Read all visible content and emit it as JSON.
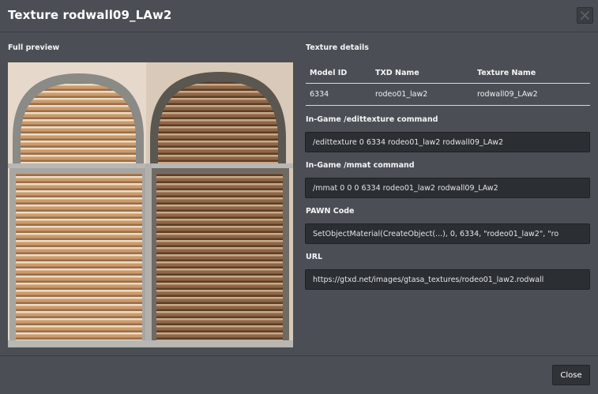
{
  "dialog": {
    "title": "Texture rodwall09_LAw2"
  },
  "preview": {
    "label": "Full preview"
  },
  "details": {
    "label": "Texture details",
    "columns": [
      "Model ID",
      "TXD Name",
      "Texture Name"
    ],
    "row": [
      "6334",
      "rodeo01_law2",
      "rodwall09_LAw2"
    ]
  },
  "commands": {
    "edittexture_label": "In-Game /edittexture command",
    "edittexture_value": "/edittexture 0 6334 rodeo01_law2 rodwall09_LAw2",
    "mmat_label": "In-Game /mmat command",
    "mmat_value": "/mmat 0 0 0 6334 rodeo01_law2 rodwall09_LAw2",
    "pawn_label": "PAWN Code",
    "pawn_value": "SetObjectMaterial(CreateObject(...), 0, 6334, \"rodeo01_law2\", \"ro",
    "url_label": "URL",
    "url_value": "https://gtxd.net/images/gtasa_textures/rodeo01_law2.rodwall"
  },
  "footer": {
    "close_label": "Close"
  },
  "colors": {
    "background": "#4b4f55",
    "input_bg": "#2b2e33",
    "text": "#eef0f2"
  }
}
